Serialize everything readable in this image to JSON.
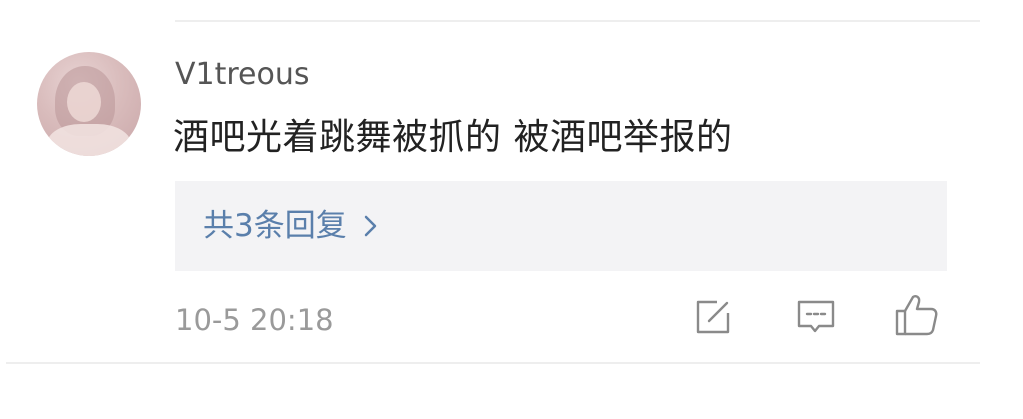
{
  "comment": {
    "username": "V1treous",
    "text": "酒吧光着跳舞被抓的 被酒吧举报的",
    "timestamp": "10-5 20:18",
    "replies_label": "共3条回复",
    "avatar_icon": "user-avatar"
  },
  "actions": {
    "share_icon": "share-icon",
    "reply_icon": "comment-icon",
    "like_icon": "thumbs-up-icon"
  },
  "colors": {
    "link": "#5a7fab",
    "username": "#555555",
    "text": "#222222",
    "meta": "#9a9a9a",
    "reply_bg": "#f3f3f5"
  }
}
